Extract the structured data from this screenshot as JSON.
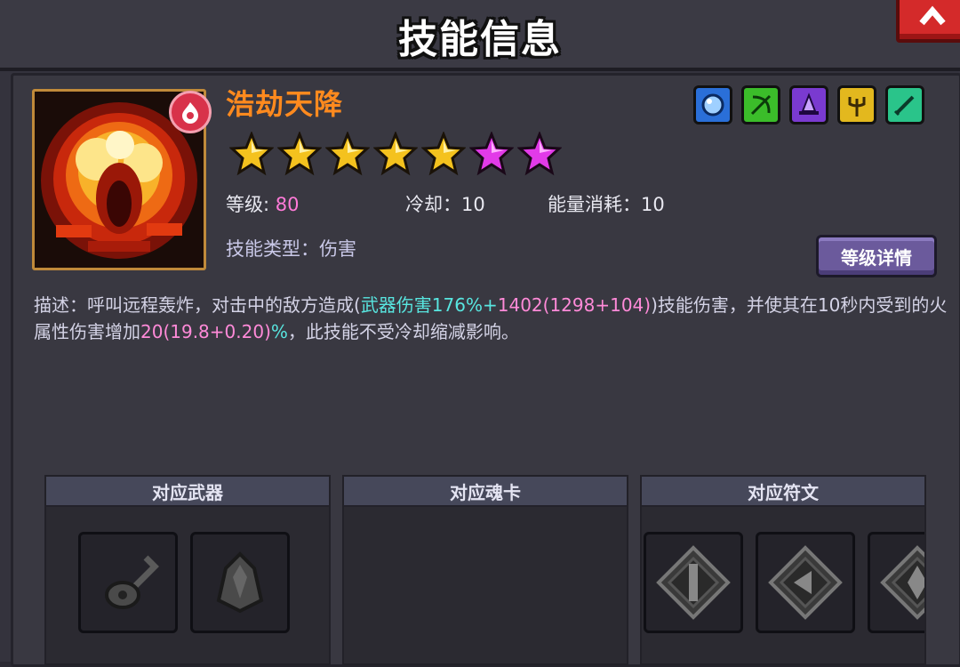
{
  "window": {
    "title": "技能信息"
  },
  "skill": {
    "name": "浩劫天降",
    "stars": {
      "gold": 5,
      "pink": 2
    },
    "level_label": "等级:",
    "level_value": "80",
    "cooldown_label": "冷却：",
    "cooldown_value": "10",
    "energy_label": "能量消耗：",
    "energy_value": "10",
    "type_label": "技能类型：",
    "type_value": "伤害",
    "detail_button": "等级详情",
    "attribute_icons": [
      "water-orb-icon",
      "bow-icon",
      "wizard-hat-icon",
      "trident-icon",
      "blade-icon"
    ]
  },
  "description": {
    "prefix": "描述：呼叫远程轰炸，对击中的敌方造成(",
    "weapon_damage": "武器伤害176%+",
    "damage_value": "1402(1298+104)",
    "middle": ")技能伤害，并使其在10秒内受到的火属性伤害增加",
    "increase_value": "20(19.8+0.20)",
    "percent": "%",
    "suffix": "，此技能不受冷却缩减影响。"
  },
  "sections": {
    "weapons": {
      "title": "对应武器",
      "items": [
        "guitar-weapon-icon",
        "armor-weapon-icon"
      ]
    },
    "soul_cards": {
      "title": "对应魂卡",
      "items": []
    },
    "runes": {
      "title": "对应符文",
      "items": [
        "rune-sword-icon",
        "rune-arrow-icon",
        "rune-crystal-icon"
      ]
    }
  },
  "colors": {
    "skill_name": "#ff8a1e",
    "stat_value": "#ff7ad8",
    "highlight_cyan": "#58e6e0",
    "highlight_pink": "#ff8ad8",
    "close_button": "#d42a2a",
    "detail_button": "#6b5a9c"
  }
}
